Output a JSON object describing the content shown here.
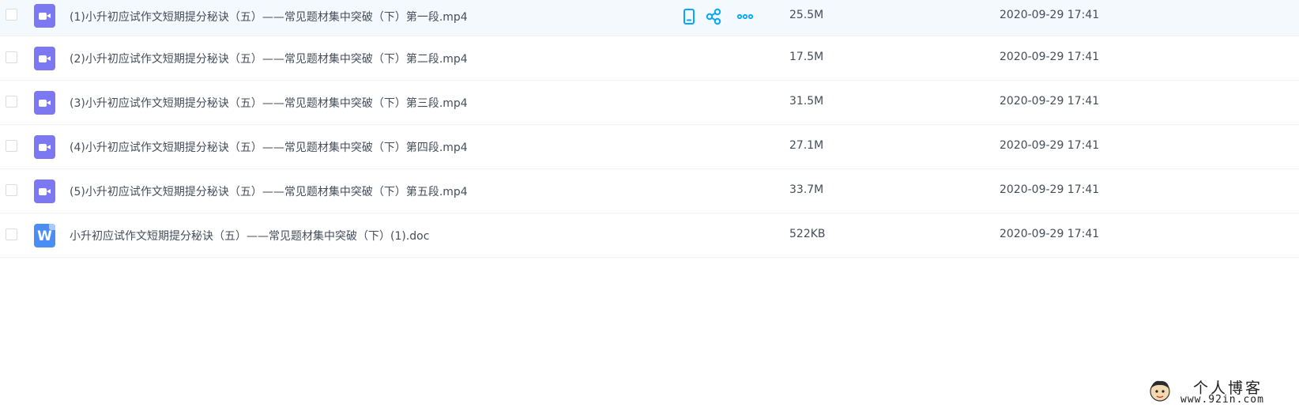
{
  "files": [
    {
      "name": "(1)小升初应试作文短期提分秘诀（五）——常见题材集中突破（下）第一段.mp4",
      "size": "25.5M",
      "date": "2020-09-29 17:41",
      "type": "video-icon",
      "hover": true
    },
    {
      "name": "(2)小升初应试作文短期提分秘诀（五）——常见题材集中突破（下）第二段.mp4",
      "size": "17.5M",
      "date": "2020-09-29 17:41",
      "type": "video-icon"
    },
    {
      "name": "(3)小升初应试作文短期提分秘诀（五）——常见题材集中突破（下）第三段.mp4",
      "size": "31.5M",
      "date": "2020-09-29 17:41",
      "type": "video-icon"
    },
    {
      "name": "(4)小升初应试作文短期提分秘诀（五）——常见题材集中突破（下）第四段.mp4",
      "size": "27.1M",
      "date": "2020-09-29 17:41",
      "type": "video-icon"
    },
    {
      "name": "(5)小升初应试作文短期提分秘诀（五）——常见题材集中突破（下）第五段.mp4",
      "size": "33.7M",
      "date": "2020-09-29 17:41",
      "type": "video-icon"
    },
    {
      "name": "小升初应试作文短期提分秘诀（五）——常见题材集中突破（下）(1).doc",
      "size": "522KB",
      "date": "2020-09-29 17:41",
      "type": "word-doc-icon",
      "letter": "W"
    }
  ],
  "row_actions": [
    "phone-icon",
    "share-icon",
    "more-icon"
  ],
  "watermark": {
    "title": "个人博客",
    "url": "www.92in.com"
  },
  "colors": {
    "accent": "#06a7ff",
    "video": "#7b78f2",
    "doc": "#4a8ef5",
    "hover_row": "#f4f9fd"
  }
}
